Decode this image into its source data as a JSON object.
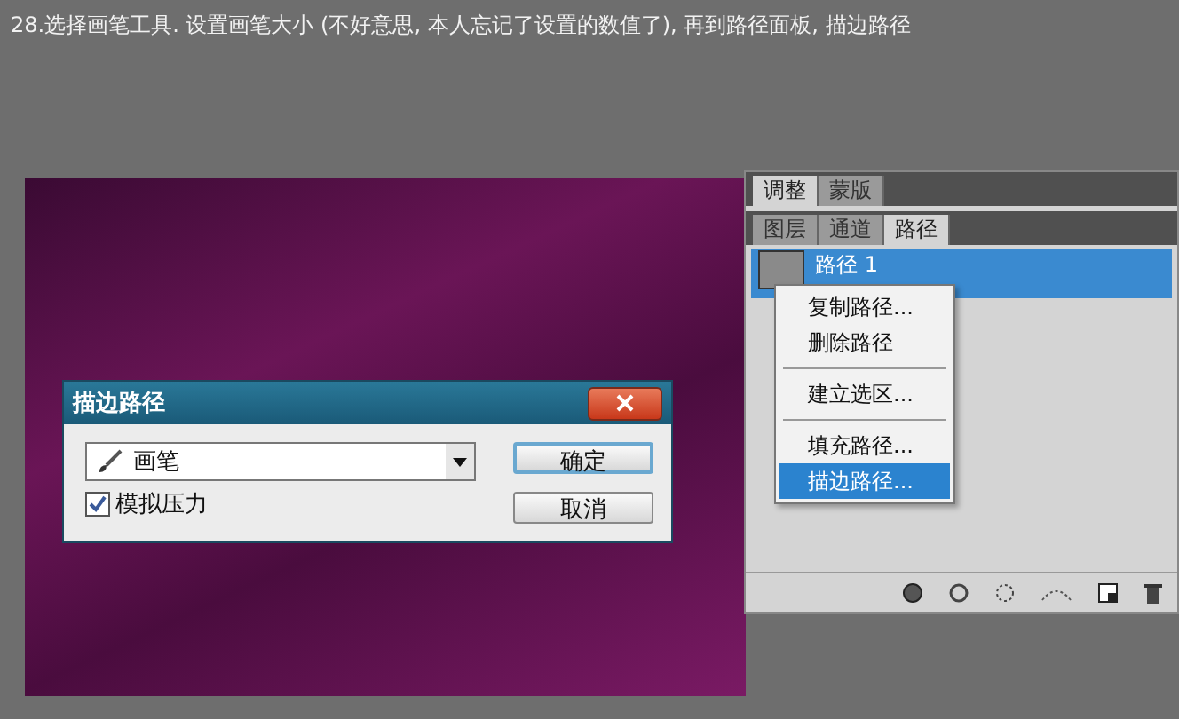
{
  "caption": "28.选择画笔工具. 设置画笔大小 (不好意思, 本人忘记了设置的数值了), 再到路径面板, 描边路径",
  "panel": {
    "top_tabs": [
      {
        "label": "调整",
        "selected": true
      },
      {
        "label": "蒙版",
        "selected": false
      }
    ],
    "tabs": [
      {
        "label": "图层",
        "selected": false
      },
      {
        "label": "通道",
        "selected": false
      },
      {
        "label": "路径",
        "selected": true
      }
    ],
    "paths": [
      {
        "name": "路径 1",
        "selected": true
      }
    ]
  },
  "context_menu": {
    "groups": [
      [
        {
          "label": "复制路径...",
          "selected": false
        },
        {
          "label": "删除路径",
          "selected": false
        }
      ],
      [
        {
          "label": "建立选区...",
          "selected": false
        }
      ],
      [
        {
          "label": "填充路径...",
          "selected": false
        },
        {
          "label": "描边路径...",
          "selected": true
        }
      ]
    ]
  },
  "dialog": {
    "title": "描边路径",
    "tool": "画笔",
    "pressure": {
      "label": "模拟压力",
      "checked": true
    },
    "buttons": [
      {
        "label": "确定",
        "default": true
      },
      {
        "label": "取消",
        "default": false
      }
    ]
  }
}
